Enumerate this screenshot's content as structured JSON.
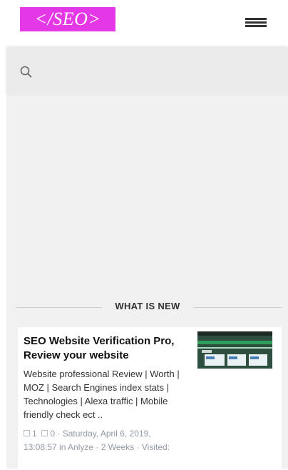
{
  "header": {
    "logo_text": "</SEO>",
    "menu_icon": "hamburger-icon"
  },
  "search": {
    "icon": "search-icon"
  },
  "section": {
    "title": "WHAT IS NEW"
  },
  "article": {
    "title": "SEO Website Verification Pro, Review your website",
    "description": "Website professional Review | Worth | MOZ | Search Engines index stats | Technologies | Alexa traffic | Mobile friendly check ect ..",
    "likes": "1",
    "comments": "0",
    "meta_line1": "· Saturday, April 6, 2019,",
    "meta_line2": "13:08:57 in Anlyze · 2 Weeks · Visited:",
    "thumbnail": "website-screenshot-thumbnail"
  },
  "colors": {
    "logo_bg": "#e437e6",
    "search_bg": "#ebebeb",
    "content_bg": "#f1f1f1",
    "meta_text": "#9099a6"
  }
}
